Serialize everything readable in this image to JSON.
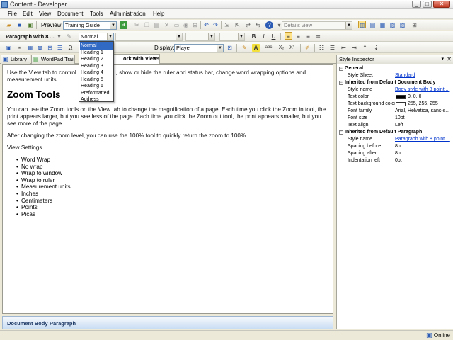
{
  "window": {
    "title": "Content - Developer",
    "minimize": "_",
    "maximize": "□",
    "close": "✕"
  },
  "menu": [
    "File",
    "Edit",
    "View",
    "Document",
    "Tools",
    "Administration",
    "Help"
  ],
  "toolbar1": {
    "preview_label": "Preview:",
    "preview_value": "Training Guide",
    "view_value": "Details view"
  },
  "toolbar2": {
    "paragraph_label": "Paragraph with 8 ...",
    "style_value": "Normal"
  },
  "toolbar3": {
    "display_label": "Display:",
    "display_value": "Player"
  },
  "style_dropdown": {
    "options": [
      "Normal",
      "Heading 1",
      "Heading 2",
      "Heading 3",
      "Heading 4",
      "Heading 5",
      "Heading 6",
      "Preformatted",
      "Address"
    ],
    "selected": "Normal"
  },
  "tabs": [
    {
      "label": "Library",
      "active": false
    },
    {
      "label": "WordPad Trai",
      "active": false
    },
    {
      "label": "ork with Views",
      "active": true
    }
  ],
  "document": {
    "intro_a": "Use the View tab to control",
    "intro_b": "l, show or hide the ruler and status bar, change word wrapping options and measurement units.",
    "heading": "Zoom Tools",
    "para1": "You can use the Zoom tools on the View tab to change the magnification of a page. Each time you click the Zoom in tool, the print appears larger, but you see less of the page. Each time you click the Zoom out tool, the print appears smaller, but you see more of the page.",
    "para2": "After changing the zoom level, you can use the 100% tool to quickly return the zoom to 100%.",
    "view_settings": "View Settings",
    "list": [
      "Word Wrap",
      "No wrap",
      "Wrap to window",
      "Wrap to ruler",
      "Measurement units",
      "Inches",
      "Centimeters",
      "Points",
      "Picas"
    ]
  },
  "doc_status": {
    "item1": "Document Body",
    "item2": "Paragraph"
  },
  "inspector": {
    "title": "Style Inspector",
    "groups": {
      "general": "General",
      "inherited_body": "Inherited from Default Document Body",
      "inherited_paragraph": "Inherited from Default Paragraph"
    },
    "rows": {
      "style_sheet_label": "Style Sheet",
      "style_sheet_value": "Standard",
      "body_style_name_label": "Style name",
      "body_style_name_value": "Body style with 8 point ...",
      "text_color_label": "Text color",
      "text_color_value": "0, 0, 0",
      "text_bg_label": "Text background color",
      "text_bg_value": "255, 255, 255",
      "font_family_label": "Font family",
      "font_family_value": "Arial, Helvetica, sans-s...",
      "font_size_label": "Font size",
      "font_size_value": "10pt",
      "text_align_label": "Text align",
      "text_align_value": "Left",
      "para_style_name_label": "Style name",
      "para_style_name_value": "Paragraph with 8 point ...",
      "spacing_before_label": "Spacing before",
      "spacing_before_value": "8pt",
      "spacing_after_label": "Spacing after",
      "spacing_after_value": "8pt",
      "indentation_left_label": "Indentation left",
      "indentation_left_value": "0pt"
    },
    "swatch_colors": {
      "text": "#000000",
      "background": "#FFFFFF"
    }
  },
  "app_status": {
    "online": "Online"
  },
  "colors": {
    "selection": "#316AC5",
    "link": "#0033CC",
    "status_gradient_end": "#C9DDF3"
  }
}
